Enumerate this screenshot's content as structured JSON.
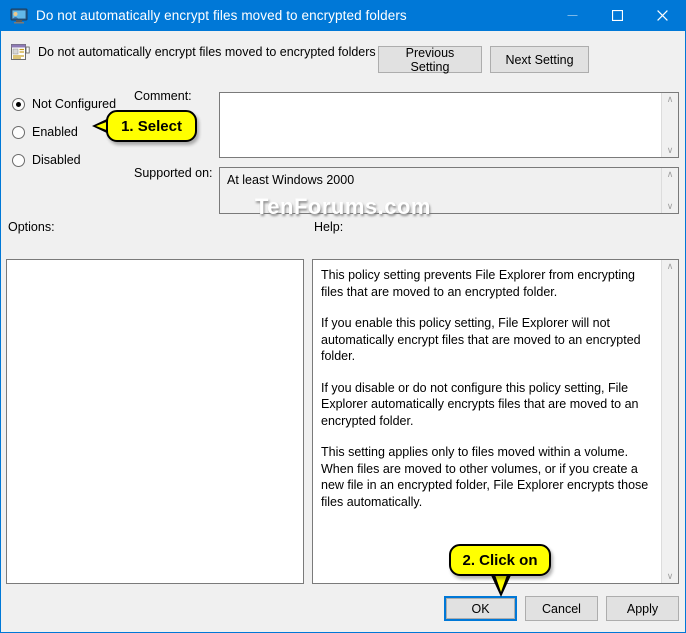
{
  "window": {
    "title": "Do not automatically encrypt files moved to encrypted folders",
    "icon": "group-policy-setting-icon",
    "accent_color": "#0078d7",
    "controls": {
      "minimize": "–",
      "maximize": "☐",
      "close": "✕"
    }
  },
  "header": {
    "setting_name": "Do not automatically encrypt files moved to encrypted folders",
    "icon": "policy-document-icon",
    "previous_label": "Previous Setting",
    "next_label": "Next Setting"
  },
  "state": {
    "options": [
      {
        "label": "Not Configured",
        "checked": true
      },
      {
        "label": "Enabled",
        "checked": false
      },
      {
        "label": "Disabled",
        "checked": false
      }
    ]
  },
  "comment": {
    "label": "Comment:",
    "value": "",
    "scroll_up": "∧",
    "scroll_down": "∨"
  },
  "supported": {
    "label": "Supported on:",
    "value": "At least Windows 2000",
    "scroll_up": "∧",
    "scroll_down": "∨"
  },
  "options_pane": {
    "label": "Options:",
    "value": ""
  },
  "help_pane": {
    "label": "Help:",
    "scroll_up": "∧",
    "scroll_down": "∨",
    "paragraphs": [
      "This policy setting prevents File Explorer from encrypting files that are moved to an encrypted folder.",
      "If you enable this policy setting, File Explorer will not automatically encrypt files that are moved to an encrypted folder.",
      "If you disable or do not configure this policy setting, File Explorer automatically encrypts files that are moved to an encrypted folder.",
      "This setting applies only to files moved within a volume. When files are moved to other volumes, or if you create a new file in an encrypted folder, File Explorer encrypts those files automatically."
    ]
  },
  "footer": {
    "ok_label": "OK",
    "cancel_label": "Cancel",
    "apply_label": "Apply"
  },
  "annotations": {
    "step1": "1. Select",
    "step2": "2. Click on",
    "callout_fill": "#ffff00",
    "callout_border": "#000000"
  },
  "watermark": {
    "text": "TenForums.com"
  }
}
